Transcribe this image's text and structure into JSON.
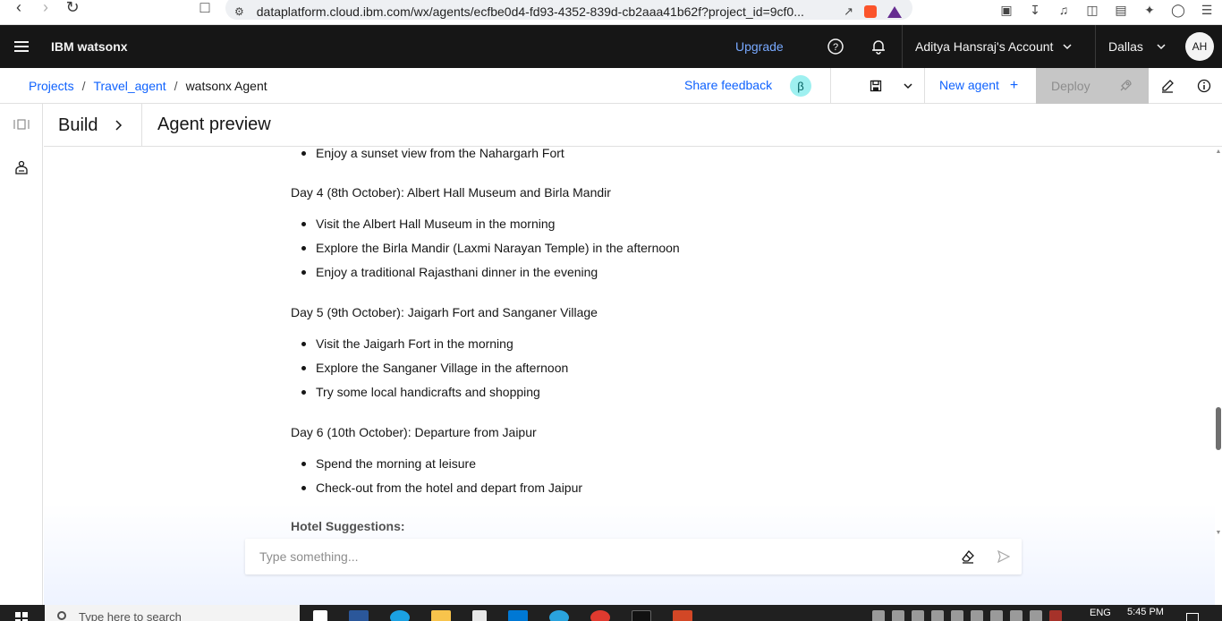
{
  "browser": {
    "url": "dataplatform.cloud.ibm.com/wx/agents/ecfbe0d4-fd93-4352-839d-cb2aaa41b62f?project_id=9cf0..."
  },
  "header": {
    "brand": "IBM watsonx",
    "upgrade": "Upgrade",
    "account": "Aditya Hansraj's Account",
    "region": "Dallas",
    "avatar": "AH"
  },
  "breadcrumb": {
    "items": [
      "Projects",
      "Travel_agent",
      "watsonx Agent"
    ],
    "separator": "/"
  },
  "toolbar": {
    "share_feedback": "Share feedback",
    "beta": "β",
    "new_agent": "New agent",
    "deploy": "Deploy"
  },
  "panel": {
    "build": "Build",
    "title": "Agent preview"
  },
  "chat": {
    "top_item": "Enjoy a sunset view from the Nahargarh Fort",
    "days": [
      {
        "heading": "Day 4 (8th October): Albert Hall Museum and Birla Mandir",
        "items": [
          "Visit the Albert Hall Museum in the morning",
          "Explore the Birla Mandir (Laxmi Narayan Temple) in the afternoon",
          "Enjoy a traditional Rajasthani dinner in the evening"
        ]
      },
      {
        "heading": "Day 5 (9th October): Jaigarh Fort and Sanganer Village",
        "items": [
          "Visit the Jaigarh Fort in the morning",
          "Explore the Sanganer Village in the afternoon",
          "Try some local handicrafts and shopping"
        ]
      },
      {
        "heading": "Day 6 (10th October): Departure from Jaipur",
        "items": [
          "Spend the morning at leisure",
          "Check-out from the hotel and depart from Jaipur"
        ]
      }
    ],
    "hotel_heading": "Hotel Suggestions:",
    "input_placeholder": "Type something..."
  },
  "taskbar": {
    "search_placeholder": "Type here to search",
    "lang": "ENG",
    "time": "5:45 PM"
  },
  "colors": {
    "header_bg": "#161616",
    "link": "#0f62fe",
    "upgrade": "#78a9ff",
    "beta_bg": "#9ef0f0",
    "deploy_bg": "#c6c6c6"
  }
}
